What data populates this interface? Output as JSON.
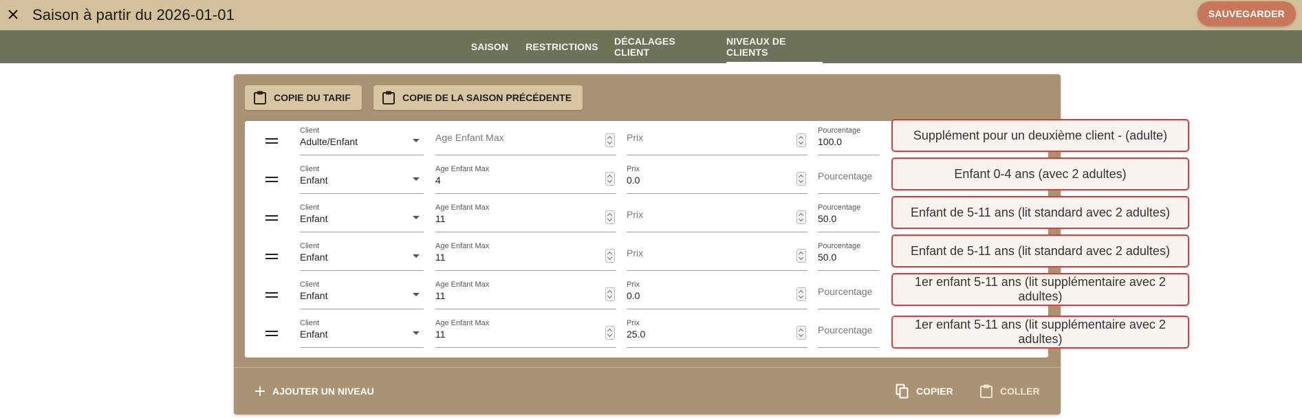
{
  "header": {
    "title": "Saison à partir du 2026-01-01",
    "save_label": "SAUVEGARDER",
    "close_icon": "close-icon"
  },
  "tabs": [
    {
      "label": "SAISON",
      "active": false
    },
    {
      "label": "RESTRICTIONS",
      "active": false
    },
    {
      "label": "DÉCALAGES CLIENT",
      "active": false
    },
    {
      "label": "NIVEAUX DE CLIENTS",
      "active": true
    }
  ],
  "toolbar": {
    "copy_tariff_label": "COPIE DU TARIF",
    "copy_previous_label": "COPIE DE LA SAISON PRÉCÉDENTE"
  },
  "fields": {
    "client_label": "Client",
    "age_label": "Age Enfant Max",
    "price_label": "Prix",
    "percent_label": "Pourcentage"
  },
  "rows": [
    {
      "client": "Adulte/Enfant",
      "age": "",
      "price": "",
      "percent": "100.0",
      "description": "Supplément pour un deuxième client - (adulte)"
    },
    {
      "client": "Enfant",
      "age": "4",
      "price": "0.0",
      "percent": "",
      "description": "Enfant 0-4 ans (avec 2 adultes)"
    },
    {
      "client": "Enfant",
      "age": "11",
      "price": "",
      "percent": "50.0",
      "description": "Enfant de 5-11 ans (lit standard avec 2 adultes)"
    },
    {
      "client": "Enfant",
      "age": "11",
      "price": "",
      "percent": "50.0",
      "description": "Enfant de 5-11 ans (lit standard avec 2 adultes)"
    },
    {
      "client": "Enfant",
      "age": "11",
      "price": "0.0",
      "percent": "",
      "description": "1er enfant 5-11 ans (lit supplémentaire avec 2 adultes)"
    },
    {
      "client": "Enfant",
      "age": "11",
      "price": "25.0",
      "percent": "",
      "description": "1er enfant 5-11 ans (lit supplémentaire avec 2 adultes)"
    }
  ],
  "footer": {
    "add_level_label": "AJOUTER UN NIVEAU",
    "copy_label": "COPIER",
    "paste_label": "COLLER"
  },
  "colors": {
    "header_bg": "#d3c19c",
    "tabs_bg": "#6b7458",
    "card_bg": "#a99372",
    "accent": "#c9765a",
    "annotation_border": "#dd3c3c"
  }
}
